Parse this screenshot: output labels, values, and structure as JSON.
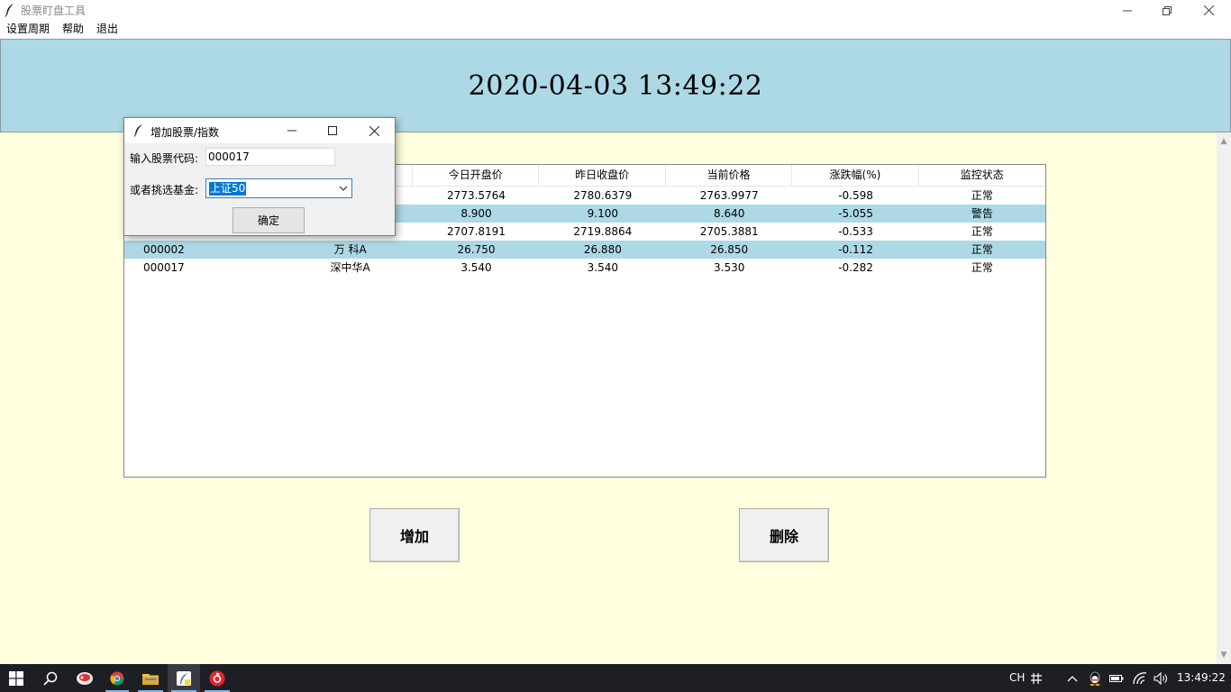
{
  "window": {
    "title": "股票盯盘工具"
  },
  "menu": {
    "items": [
      "设置周期",
      "帮助",
      "退出"
    ]
  },
  "clock": {
    "text": "2020-04-03 13:49:22"
  },
  "table": {
    "headers": [
      "",
      "",
      "今日开盘价",
      "昨日收盘价",
      "当前价格",
      "涨跌幅(%)",
      "监控状态"
    ],
    "rows": [
      {
        "code": "",
        "name": "",
        "open": "2773.5764",
        "prev_close": "2780.6379",
        "price": "2763.9977",
        "change": "-0.598",
        "status": "正常"
      },
      {
        "code": "",
        "name": "",
        "open": "8.900",
        "prev_close": "9.100",
        "price": "8.640",
        "change": "-5.055",
        "status": "警告"
      },
      {
        "code": "",
        "name": "",
        "open": "2707.8191",
        "prev_close": "2719.8864",
        "price": "2705.3881",
        "change": "-0.533",
        "status": "正常"
      },
      {
        "code": "000002",
        "name": "万 科A",
        "open": "26.750",
        "prev_close": "26.880",
        "price": "26.850",
        "change": "-0.112",
        "status": "正常"
      },
      {
        "code": "000017",
        "name": "深中华A",
        "open": "3.540",
        "prev_close": "3.540",
        "price": "3.530",
        "change": "-0.282",
        "status": "正常"
      }
    ]
  },
  "buttons": {
    "add": "增加",
    "delete": "删除"
  },
  "dialog": {
    "title": "增加股票/指数",
    "code_label": "输入股票代码:",
    "code_value": "000017",
    "fund_label": "或者挑选基金:",
    "fund_selected": "上证50",
    "ok": "确定"
  },
  "taskbar": {
    "lang": "CH",
    "time": "13:49:22"
  },
  "colors": {
    "banner": "#add8e6",
    "main_bg": "#ffffdf",
    "alt_row": "#add8e6",
    "taskbar": "#1e1f25",
    "select_highlight": "#0078d7"
  }
}
